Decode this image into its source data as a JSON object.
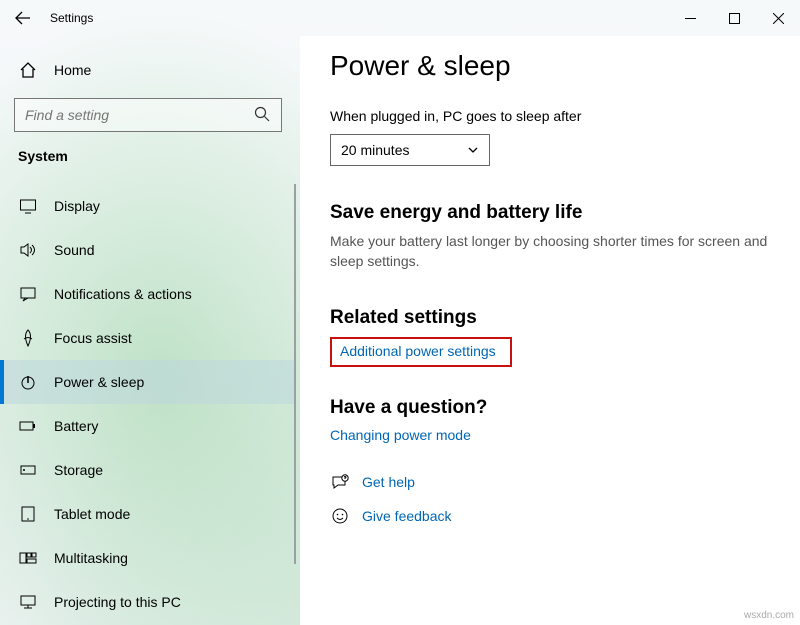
{
  "window": {
    "title": "Settings"
  },
  "sidebar": {
    "home": "Home",
    "search_placeholder": "Find a setting",
    "category": "System",
    "items": [
      {
        "label": "Display"
      },
      {
        "label": "Sound"
      },
      {
        "label": "Notifications & actions"
      },
      {
        "label": "Focus assist"
      },
      {
        "label": "Power & sleep"
      },
      {
        "label": "Battery"
      },
      {
        "label": "Storage"
      },
      {
        "label": "Tablet mode"
      },
      {
        "label": "Multitasking"
      },
      {
        "label": "Projecting to this PC"
      }
    ]
  },
  "main": {
    "title": "Power & sleep",
    "sleep_label": "When plugged in, PC goes to sleep after",
    "sleep_value": "20 minutes",
    "energy_heading": "Save energy and battery life",
    "energy_desc": "Make your battery last longer by choosing shorter times for screen and sleep settings.",
    "related_heading": "Related settings",
    "related_link": "Additional power settings",
    "question_heading": "Have a question?",
    "question_link": "Changing power mode",
    "get_help": "Get help",
    "give_feedback": "Give feedback"
  },
  "watermark": "wsxdn.com"
}
